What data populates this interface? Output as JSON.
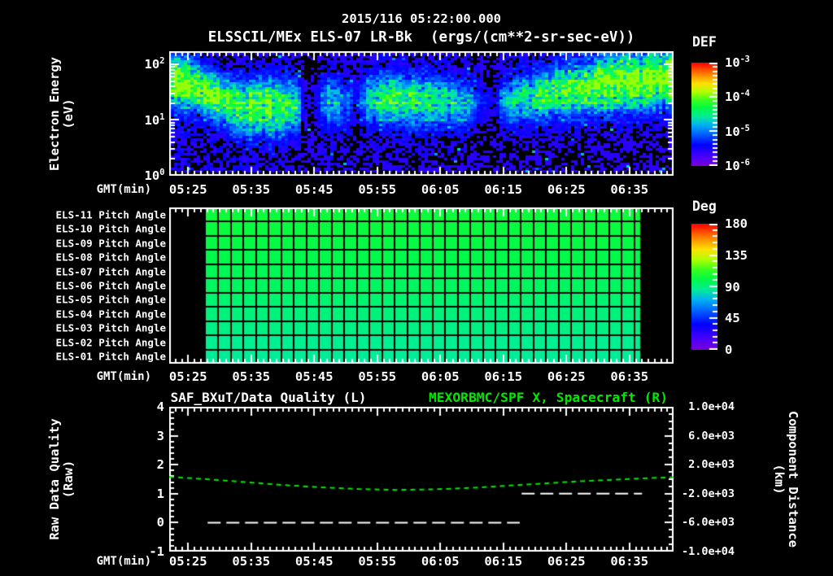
{
  "header": {
    "datetime": "2015/116 05:22:00.000",
    "source": "ELSSCIL/MEx ELS-07 LR-Bk",
    "units": "(ergs/(cm**2-sr-sec-eV))"
  },
  "time_axis": {
    "label": "GMT(min)",
    "start": "05:22",
    "end": "06:42",
    "major_tick_labels": [
      "05:25",
      "05:35",
      "05:45",
      "05:55",
      "06:05",
      "06:15",
      "06:25",
      "06:35"
    ],
    "minor_tick_minutes": 1,
    "major_tick_minutes": 10
  },
  "energy_panel": {
    "ylabel": "Electron Energy",
    "ylabel_units": "(eV)",
    "ytick_base": "10",
    "ytick_exponents": [
      "2",
      "1",
      "0"
    ],
    "colorbar": {
      "title": "DEF",
      "tick_base": "10",
      "tick_exponents": [
        "-3",
        "-4",
        "-5",
        "-6"
      ]
    }
  },
  "pitch_panel": {
    "row_labels": [
      "ELS-11 Pitch Angle",
      "ELS-10 Pitch Angle",
      "ELS-09 Pitch Angle",
      "ELS-08 Pitch Angle",
      "ELS-07 Pitch Angle",
      "ELS-06 Pitch Angle",
      "ELS-05 Pitch Angle",
      "ELS-04 Pitch Angle",
      "ELS-03 Pitch Angle",
      "ELS-02 Pitch Angle",
      "ELS-01 Pitch Angle"
    ],
    "colorbar": {
      "title": "Deg",
      "tick_labels": [
        "180",
        "135",
        "90",
        "45",
        "0"
      ]
    }
  },
  "quality_panel": {
    "title_left": "SAF_BXuT/Data Quality (L)",
    "title_right": "MEXORBMC/SPF X, Spacecraft (R)",
    "ylabel": "Raw Data Quality",
    "ylabel_units": "(Raw)",
    "ytick_labels": [
      "4",
      "3",
      "2",
      "1",
      "0",
      "-1"
    ],
    "right_tick_labels": [
      " 1.0e+04",
      " 6.0e+03",
      " 2.0e+03",
      "-2.0e+03",
      "-6.0e+03",
      "-1.0e+04"
    ],
    "right_label": "Component Distance",
    "right_label_units": "(km)"
  },
  "colors": {
    "background": "#000000",
    "foreground": "#ffffff",
    "series_green": "#00e800"
  },
  "chart_data": [
    {
      "type": "heatmap",
      "name": "electron-energy-spectrogram",
      "x_start_min": 22,
      "x_end_min": 102,
      "y_scale": "log",
      "y_range_ev": [
        1,
        171
      ],
      "z_label": "DEF",
      "z_range": [
        1e-06,
        0.001
      ],
      "seed": 42,
      "band_keyframes": [
        [
          0.0,
          1.74,
          1.0,
          0.3
        ],
        [
          0.055,
          1.56,
          0.92,
          0.27
        ],
        [
          0.105,
          1.33,
          0.82,
          0.26
        ],
        [
          0.15,
          1.22,
          0.92,
          0.31
        ],
        [
          0.21,
          1.23,
          0.9,
          0.31
        ],
        [
          0.252,
          1.26,
          0.62,
          0.28
        ],
        [
          0.262,
          1.26,
          0.06,
          0.26
        ],
        [
          0.29,
          1.28,
          0.1,
          0.26
        ],
        [
          0.31,
          1.31,
          0.55,
          0.27
        ],
        [
          0.352,
          1.32,
          0.28,
          0.26
        ],
        [
          0.368,
          1.33,
          0.12,
          0.26
        ],
        [
          0.385,
          1.34,
          0.45,
          0.27
        ],
        [
          0.43,
          1.37,
          0.7,
          0.29
        ],
        [
          0.5,
          1.33,
          0.66,
          0.29
        ],
        [
          0.57,
          1.29,
          0.6,
          0.27
        ],
        [
          0.625,
          1.26,
          0.12,
          0.26
        ],
        [
          0.648,
          1.27,
          0.1,
          0.26
        ],
        [
          0.668,
          1.3,
          0.5,
          0.26
        ],
        [
          0.73,
          1.4,
          0.72,
          0.27
        ],
        [
          0.8,
          1.52,
          0.88,
          0.3
        ],
        [
          0.9,
          1.65,
          1.0,
          0.32
        ],
        [
          1.0,
          1.73,
          1.0,
          0.33
        ]
      ]
    },
    {
      "type": "heatmap",
      "name": "pitch-angle-coverage",
      "data_start_min": 27.8,
      "data_end_min": 96.7,
      "cell_minutes": 2,
      "z_units": "Deg",
      "z_range": [
        0,
        180
      ],
      "row_angles_deg": [
        104,
        103,
        102,
        100,
        98,
        96,
        93,
        91,
        89,
        87,
        86
      ]
    },
    {
      "type": "line",
      "name": "quality-and-distance",
      "x_start_min": 22,
      "x_end_min": 102,
      "left_ylim": [
        -1,
        4
      ],
      "right_ylim": [
        -10000,
        10000
      ],
      "series": [
        {
          "name": "SAF_BXuT/Data Quality (L)",
          "axis": "left",
          "color": "#ffffff",
          "linestyle": "dashed",
          "steps": [
            {
              "value": 0,
              "from_min": 28.1,
              "to_min": 77.6
            },
            {
              "value": 1,
              "from_min": 77.9,
              "to_min": 97.0
            }
          ]
        },
        {
          "name": "MEXORBMC/SPF X, Spacecraft (R)",
          "axis": "right",
          "color": "#00e800",
          "linestyle": "dashed",
          "points_min_km": [
            [
              22,
              320
            ],
            [
              28,
              0
            ],
            [
              34,
              -400
            ],
            [
              40,
              -800
            ],
            [
              46,
              -1120
            ],
            [
              52,
              -1360
            ],
            [
              58,
              -1480
            ],
            [
              64,
              -1400
            ],
            [
              70,
              -1200
            ],
            [
              76,
              -880
            ],
            [
              82,
              -560
            ],
            [
              88,
              -240
            ],
            [
              95,
              40
            ],
            [
              102,
              280
            ]
          ]
        }
      ]
    }
  ]
}
